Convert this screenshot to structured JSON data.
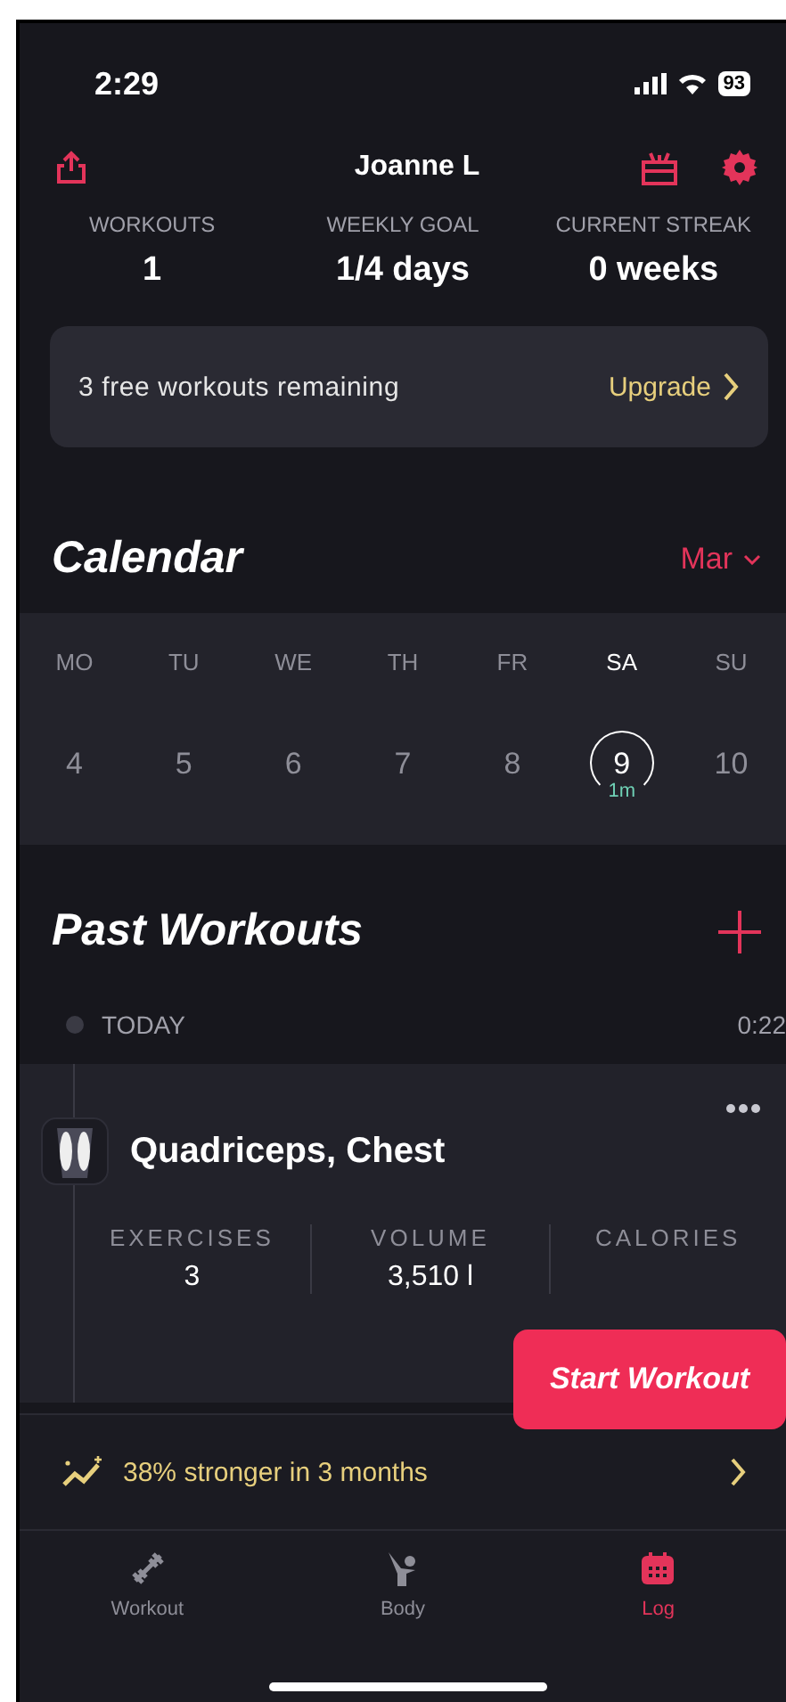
{
  "status_bar": {
    "time": "2:29",
    "battery": "93"
  },
  "header": {
    "name": "Joanne L"
  },
  "stats": [
    {
      "label": "WORKOUTS",
      "value": "1"
    },
    {
      "label": "WEEKLY GOAL",
      "value": "1/4 days"
    },
    {
      "label": "CURRENT STREAK",
      "value": "0 weeks"
    }
  ],
  "upgrade_card": {
    "text": "3 free workouts remaining",
    "action": "Upgrade"
  },
  "calendar": {
    "title": "Calendar",
    "month": "Mar",
    "days": [
      {
        "weekday": "MO",
        "date": "4",
        "selected": false
      },
      {
        "weekday": "TU",
        "date": "5",
        "selected": false
      },
      {
        "weekday": "WE",
        "date": "6",
        "selected": false
      },
      {
        "weekday": "TH",
        "date": "7",
        "selected": false
      },
      {
        "weekday": "FR",
        "date": "8",
        "selected": false
      },
      {
        "weekday": "SA",
        "date": "9",
        "selected": true,
        "note": "1m"
      },
      {
        "weekday": "SU",
        "date": "10",
        "selected": false
      }
    ]
  },
  "past_workouts": {
    "title": "Past Workouts",
    "day": "TODAY",
    "time": "0:22",
    "workout": {
      "title": "Quadriceps, Chest",
      "stats": [
        {
          "label": "EXERCISES",
          "value": "3"
        },
        {
          "label": "VOLUME",
          "value": "3,510 l"
        },
        {
          "label": "CALORIES"
        }
      ]
    }
  },
  "start_button": "Start Workout",
  "insight": "38% stronger in 3 months",
  "tab_bar": [
    {
      "label": "Workout",
      "kind": "workout",
      "selected": false
    },
    {
      "label": "Body",
      "kind": "body",
      "selected": false
    },
    {
      "label": "Log",
      "kind": "log",
      "selected": true
    }
  ]
}
